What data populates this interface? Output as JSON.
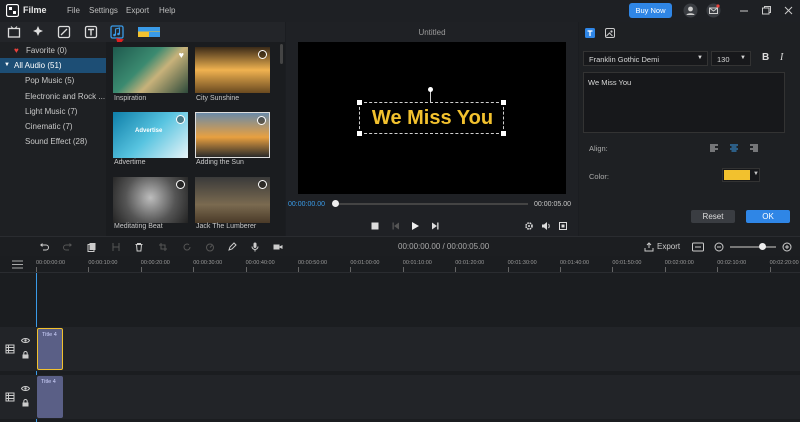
{
  "app": {
    "name": "Filme",
    "buy_now": "Buy Now"
  },
  "menu": [
    "File",
    "Settings",
    "Export",
    "Help"
  ],
  "categories": [
    {
      "label": "Favorite (0)",
      "icon": "heart-icon"
    },
    {
      "label": "All Audio (51)",
      "icon": "caret-down-icon"
    },
    {
      "label": "Pop Music (5)"
    },
    {
      "label": "Electronic and Rock ..."
    },
    {
      "label": "Light Music (7)"
    },
    {
      "label": "Cinematic (7)"
    },
    {
      "label": "Sound Effect (28)"
    }
  ],
  "media": [
    {
      "label": "Inspiration"
    },
    {
      "label": "City Sunshine"
    },
    {
      "label": "Advertime",
      "overlay": "Advertise"
    },
    {
      "label": "Adding the Sun"
    },
    {
      "label": "Meditating Beat"
    },
    {
      "label": "Jack The Lumberer"
    }
  ],
  "preview": {
    "title": "Untitled",
    "caption": "We Miss You",
    "time_current": "00:00:00.00",
    "time_total": "00:00:05.00"
  },
  "props": {
    "font": "Franklin Gothic Demi",
    "size": "130",
    "bold": "B",
    "italic": "I",
    "text": "We Miss You",
    "align_label": "Align:",
    "color_label": "Color:",
    "color": "#f2c12e",
    "reset": "Reset",
    "ok": "OK"
  },
  "timeline": {
    "timecode": "00:00:00.00 / 00:00:05.00",
    "export": "Export",
    "ticks": [
      "00:00:00:00",
      "00:00:10:00",
      "00:00:20:00",
      "00:00:30:00",
      "00:00:40:00",
      "00:00:50:00",
      "00:01:00:00",
      "00:01:10:00",
      "00:01:20:00",
      "00:01:30:00",
      "00:01:40:00",
      "00:01:50:00",
      "00:02:00:00",
      "00:02:10:00",
      "00:02:20:00"
    ],
    "clips": [
      "Title 4",
      "Title 4"
    ]
  },
  "colors": {
    "accent": "#2f86e6",
    "selection": "#1d4e75",
    "caption": "#f2c12e"
  }
}
